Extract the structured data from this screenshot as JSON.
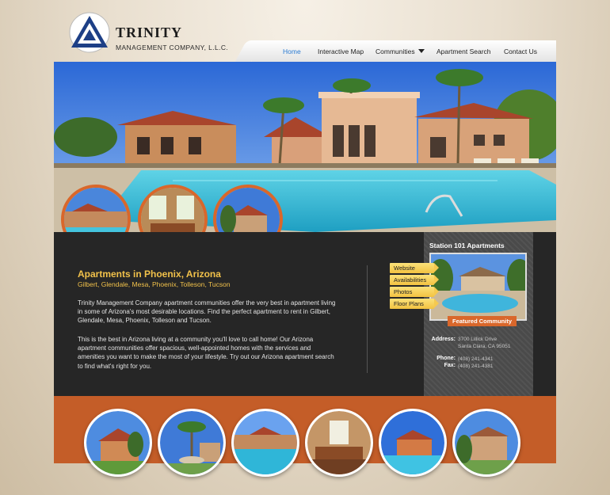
{
  "brand": {
    "name": "TRINITY",
    "subtitle": "MANAGEMENT COMPANY, L.L.C.",
    "colors": {
      "accent": "#d9672b",
      "nav_active": "#2a7ad1",
      "headline": "#f1c14a",
      "panel": "#262626",
      "band": "#c45d28"
    }
  },
  "nav": {
    "items": [
      {
        "label": "Home",
        "active": true
      },
      {
        "label": "Interactive Map"
      },
      {
        "label": "Communities",
        "icon": "caret-down-icon"
      },
      {
        "label": "Apartment Search"
      },
      {
        "label": "Contact Us"
      }
    ]
  },
  "content": {
    "headline": "Apartments in Phoenix, Arizona",
    "cities": "Gilbert, Glendale, Mesa, Phoenix, Tolleson, Tucson",
    "paragraph1_lines": [
      "Trinity Management Company apartment communities offer the very best in apartment living",
      "in some of Arizona's most desirable locations. Find the perfect apartment to rent in Gilbert,",
      "Glendale, Mesa, Phoenix, Tolleson and Tucson."
    ],
    "paragraph2_lines": [
      "This is the best in Arizona living at a community you'll love to call home! Our Arizona",
      "apartment communities offer spacious, well-appointed homes with the services and",
      "amenities you want to make the most of your lifestyle. Try out our Arizona apartment search",
      "to find what's right for you."
    ]
  },
  "featured": {
    "title": "Station 101 Apartments",
    "badge": "Featured Community",
    "tabs": [
      "Website",
      "Availabilities",
      "Photos",
      "Floor Plans"
    ],
    "address_label": "Address:",
    "address_line1": "3700 Lillick Drive",
    "address_line2": "Santa Clara, CA 95051",
    "phone_label": "Phone:",
    "phone": "(408) 241-4341",
    "fax_label": "Fax:",
    "fax": "(408) 241-4381"
  }
}
